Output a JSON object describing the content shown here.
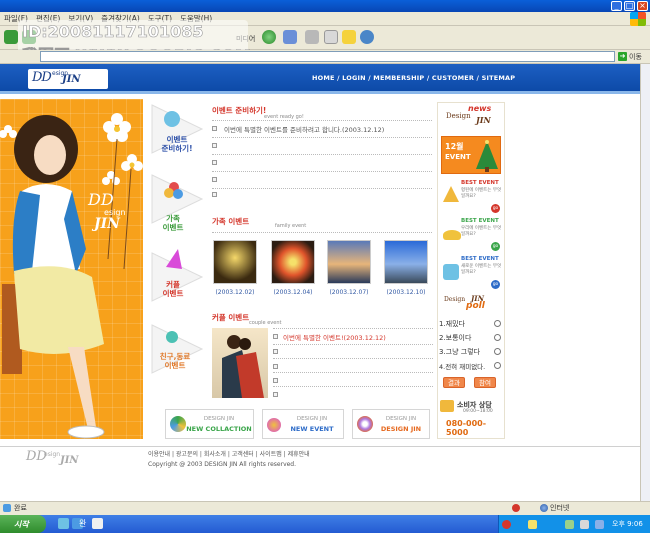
{
  "browser": {
    "menu": [
      "파일(F)",
      "편집(E)",
      "보기(V)",
      "즐겨찾기(A)",
      "도구(T)",
      "도움말(H)"
    ],
    "toolbar_media_label": "미디어",
    "go_label": "이동",
    "status_text": "완료",
    "zone_text": "인터넷"
  },
  "watermark": {
    "line1": "ID:20081117101085",
    "line2": "我图网 WWW.OOOPIC.COM"
  },
  "site": {
    "logo": {
      "dd": "DD",
      "design": "esign",
      "jin": "JIN"
    },
    "topnav": "HOME / LOGIN / MEMBERSHIP / CUSTOMER / SITEMAP",
    "hero": {
      "dd": "DD",
      "design": "esign",
      "jin": "JIN"
    },
    "side_menu": [
      {
        "line1": "이벤트",
        "line2": "준비하기!"
      },
      {
        "line1": "가족",
        "line2": "이벤트"
      },
      {
        "line1": "커플",
        "line2": "이벤트"
      },
      {
        "line1": "친구,동료",
        "line2": "이벤트"
      }
    ],
    "section1": {
      "title": "이벤트 준비하기!",
      "subtitle": "event ready go!",
      "items": [
        "이번에 특별한 이벤트를 준비하려고 합니다.(2003.12.12)",
        "",
        "",
        "",
        ""
      ]
    },
    "section2": {
      "title": "가족 이벤트",
      "subtitle": "family event",
      "photos": [
        "(2003.12.02)",
        "(2003.12.04)",
        "(2003.12.07)",
        "(2003.12.10)"
      ]
    },
    "section3": {
      "title": "커플 이벤트",
      "subtitle": "couple event",
      "items": [
        "이번에 특별한 이벤트!(2003.12.12)",
        "",
        "",
        "",
        ""
      ]
    },
    "right": {
      "news_word": "news",
      "news_design": "Design",
      "news_jin": "JIN",
      "promo_top": "12월",
      "promo_bottom": "EVENT",
      "best_events": [
        {
          "title": "BEST EVENT",
          "desc": "헝된에 이벤트는 무엇일까요?"
        },
        {
          "title": "BEST EVENT",
          "desc": "우리에 이벤트는 무엇일까요?"
        },
        {
          "title": "BEST EVENT",
          "desc": "새로운 이벤트는 무엇일까요?"
        }
      ],
      "go_label": "go",
      "poll_brand": "Design",
      "poll_jin": "JIN",
      "poll_word": "poll",
      "poll_options": [
        "1.재밌다",
        "2.보통이다",
        "3.그냥 그렇다",
        "4.전혀 재미없다."
      ],
      "poll_result": "결과",
      "poll_vote": "참여",
      "cs_title": "소비자 상담",
      "cs_hours": "09:00~18:00",
      "cs_phone": "080-000-5000"
    },
    "banners": [
      {
        "top": "DESIGN JIN",
        "bottom": "NEW COLLACTION",
        "color": "#3aa54a"
      },
      {
        "top": "DESIGN JIN",
        "bottom": "NEW EVENT",
        "color": "#2e6cc8"
      },
      {
        "top": "DESIGN JIN",
        "bottom": "DESIGN JIN",
        "color": "#e6691f"
      }
    ],
    "footer": {
      "links": "이용안내 | 광고문의 | 회사소개 | 고객센터 | 사이트맵 | 제휴안내",
      "copyright": "Copyright @ 2003 DESIGN JIN  All rights reserved.",
      "logo": {
        "dd": "DD",
        "design": "esign",
        "jin": "JIN"
      }
    }
  },
  "taskbar": {
    "start_label": "시작",
    "quick_label": "완",
    "clock": "오후 9:06"
  }
}
